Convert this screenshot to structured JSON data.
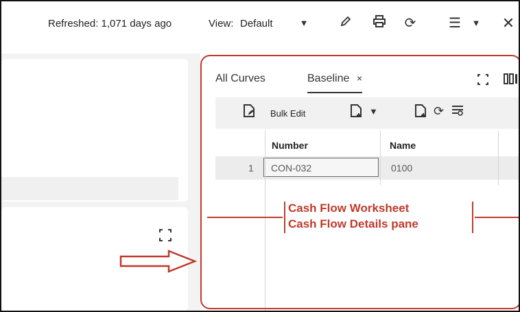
{
  "header": {
    "refreshed": "Refreshed: 1,071 days ago",
    "view_label": "View:",
    "view_value": "Default",
    "icons": [
      "pencil-icon",
      "print-icon",
      "refresh-icon",
      "menu-icon",
      "chevron-down-icon",
      "close-icon"
    ]
  },
  "panel": {
    "tabs": [
      {
        "label": "All Curves",
        "active": false
      },
      {
        "label": "Baseline",
        "active": true,
        "close": "×"
      }
    ],
    "toolbar": {
      "bulk_edit": "Bulk Edit"
    },
    "table": {
      "columns": [
        "Number",
        "Name"
      ],
      "rows": [
        {
          "index": "1",
          "number": "CON-032",
          "name": "0100"
        }
      ]
    }
  },
  "annotation": {
    "line1": "Cash Flow Worksheet",
    "line2": "Cash Flow Details pane"
  },
  "colors": {
    "annotation": "#c0392b"
  }
}
